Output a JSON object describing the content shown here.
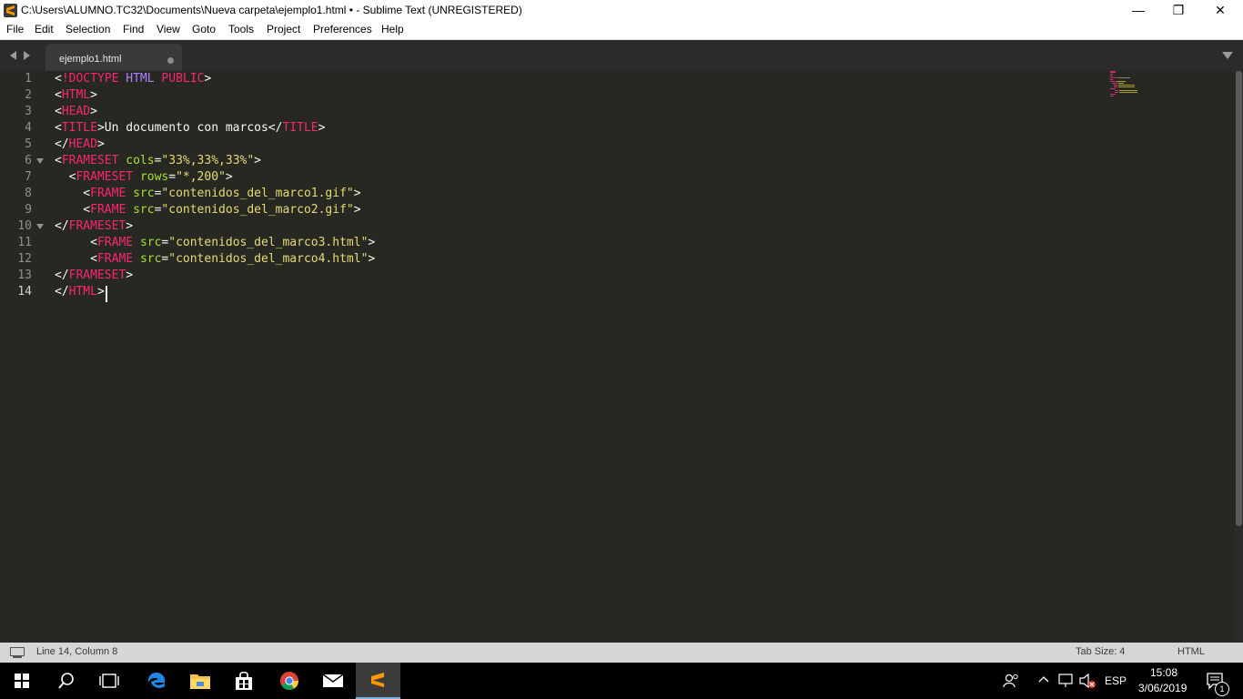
{
  "window": {
    "title": "C:\\Users\\ALUMNO.TC32\\Documents\\Nueva carpeta\\ejemplo1.html • - Sublime Text (UNREGISTERED)",
    "minimize": "—",
    "maximize": "❐",
    "close": "✕"
  },
  "menu": [
    "File",
    "Edit",
    "Selection",
    "Find",
    "View",
    "Goto",
    "Tools",
    "Project",
    "Preferences",
    "Help"
  ],
  "tab": {
    "label": "ejemplo1.html"
  },
  "editor": {
    "line_numbers": [
      "1",
      "2",
      "3",
      "4",
      "5",
      "6",
      "7",
      "8",
      "9",
      "10",
      "11",
      "12",
      "13",
      "14"
    ],
    "lines": [
      [
        {
          "t": "<",
          "c": "txt"
        },
        {
          "t": "!DOCTYPE",
          "c": "tag"
        },
        {
          "t": " ",
          "c": "txt"
        },
        {
          "t": "HTML",
          "c": "kw"
        },
        {
          "t": " ",
          "c": "txt"
        },
        {
          "t": "PUBLIC",
          "c": "tag"
        },
        {
          "t": ">",
          "c": "txt"
        }
      ],
      [
        {
          "t": "<",
          "c": "txt"
        },
        {
          "t": "HTML",
          "c": "tag"
        },
        {
          "t": ">",
          "c": "txt"
        }
      ],
      [
        {
          "t": "<",
          "c": "txt"
        },
        {
          "t": "HEAD",
          "c": "tag"
        },
        {
          "t": ">",
          "c": "txt"
        }
      ],
      [
        {
          "t": "<",
          "c": "txt"
        },
        {
          "t": "TITLE",
          "c": "tag"
        },
        {
          "t": ">Un documento con marcos</",
          "c": "txt"
        },
        {
          "t": "TITLE",
          "c": "tag"
        },
        {
          "t": ">",
          "c": "txt"
        }
      ],
      [
        {
          "t": "</",
          "c": "txt"
        },
        {
          "t": "HEAD",
          "c": "tag"
        },
        {
          "t": ">",
          "c": "txt"
        }
      ],
      [
        {
          "t": "<",
          "c": "txt"
        },
        {
          "t": "FRAMESET",
          "c": "tag"
        },
        {
          "t": " ",
          "c": "txt"
        },
        {
          "t": "cols",
          "c": "attr"
        },
        {
          "t": "=",
          "c": "txt"
        },
        {
          "t": "\"33%,33%,33%\"",
          "c": "str"
        },
        {
          "t": ">",
          "c": "txt"
        }
      ],
      [
        {
          "t": "  <",
          "c": "txt"
        },
        {
          "t": "FRAMESET",
          "c": "tag"
        },
        {
          "t": " ",
          "c": "txt"
        },
        {
          "t": "rows",
          "c": "attr"
        },
        {
          "t": "=",
          "c": "txt"
        },
        {
          "t": "\"*,200\"",
          "c": "str"
        },
        {
          "t": ">",
          "c": "txt"
        }
      ],
      [
        {
          "t": "    <",
          "c": "txt"
        },
        {
          "t": "FRAME",
          "c": "tag"
        },
        {
          "t": " ",
          "c": "txt"
        },
        {
          "t": "src",
          "c": "attr"
        },
        {
          "t": "=",
          "c": "txt"
        },
        {
          "t": "\"contenidos_del_marco1.gif\"",
          "c": "str"
        },
        {
          "t": ">",
          "c": "txt"
        }
      ],
      [
        {
          "t": "    <",
          "c": "txt"
        },
        {
          "t": "FRAME",
          "c": "tag"
        },
        {
          "t": " ",
          "c": "txt"
        },
        {
          "t": "src",
          "c": "attr"
        },
        {
          "t": "=",
          "c": "txt"
        },
        {
          "t": "\"contenidos_del_marco2.gif\"",
          "c": "str"
        },
        {
          "t": ">",
          "c": "txt"
        }
      ],
      [
        {
          "t": "</",
          "c": "txt"
        },
        {
          "t": "FRAMESET",
          "c": "tag"
        },
        {
          "t": ">",
          "c": "txt"
        }
      ],
      [
        {
          "t": "     <",
          "c": "txt"
        },
        {
          "t": "FRAME",
          "c": "tag"
        },
        {
          "t": " ",
          "c": "txt"
        },
        {
          "t": "src",
          "c": "attr"
        },
        {
          "t": "=",
          "c": "txt"
        },
        {
          "t": "\"contenidos_del_marco3.html\"",
          "c": "str"
        },
        {
          "t": ">",
          "c": "txt"
        }
      ],
      [
        {
          "t": "     <",
          "c": "txt"
        },
        {
          "t": "FRAME",
          "c": "tag"
        },
        {
          "t": " ",
          "c": "txt"
        },
        {
          "t": "src",
          "c": "attr"
        },
        {
          "t": "=",
          "c": "txt"
        },
        {
          "t": "\"contenidos_del_marco4.html\"",
          "c": "str"
        },
        {
          "t": ">",
          "c": "txt"
        }
      ],
      [
        {
          "t": "</",
          "c": "txt"
        },
        {
          "t": "FRAMESET",
          "c": "tag"
        },
        {
          "t": ">",
          "c": "txt"
        }
      ],
      [
        {
          "t": "</",
          "c": "txt"
        },
        {
          "t": "HTML",
          "c": "tag"
        },
        {
          "t": ">",
          "c": "txt"
        }
      ]
    ],
    "fold_lines": [
      "6",
      "10"
    ],
    "current_line": "14"
  },
  "status": {
    "position": "Line 14, Column 8",
    "tab_size": "Tab Size: 4",
    "syntax": "HTML"
  },
  "taskbar": {
    "icons": [
      "windows-start-icon",
      "search-icon",
      "task-view-icon",
      "edge-icon",
      "file-explorer-icon",
      "store-icon",
      "chrome-icon",
      "mail-icon",
      "sublime-text-icon"
    ],
    "language": "ESP",
    "time": "15:08",
    "date": "3/06/2019",
    "notification_count": "1"
  },
  "colors": {
    "editor_bg": "#272822",
    "tag": "#f92672",
    "attribute": "#a6e22e",
    "string": "#e6db74",
    "keyword": "#ae81ff",
    "text": "#f8f8f2"
  }
}
